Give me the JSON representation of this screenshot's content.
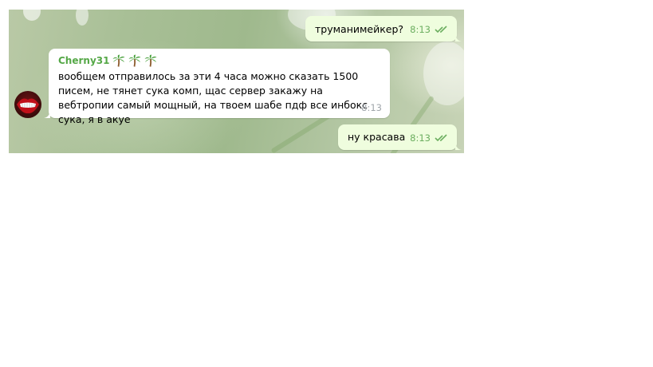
{
  "messages": [
    {
      "direction": "outgoing",
      "text": "труманимейкер?",
      "time": "8:13",
      "status": "read"
    },
    {
      "direction": "incoming",
      "sender": "Cherny31",
      "sender_emoji": [
        "palm-tree",
        "palm-tree",
        "palm-tree"
      ],
      "text": "вообщем отправилось за эти 4 часа можно сказать 1500 писем, не тянет сука комп, щас сервер закажу на вебтропии самый мощный, на твоем шабе пдф все инбокс сука, я в акуе",
      "time": "8:13"
    },
    {
      "direction": "outgoing",
      "text": "ну красава",
      "time": "8:13",
      "status": "read"
    }
  ],
  "colors": {
    "outgoing_bubble": "#effdde",
    "incoming_bubble": "#ffffff",
    "sender_name": "#55a847",
    "read_checks": "#6cae60",
    "time_incoming": "#a0a6ab"
  },
  "icons": {
    "read_status": "double-check-icon",
    "avatar": "lips-avatar",
    "sender_emoji": "palm-tree-icon"
  }
}
